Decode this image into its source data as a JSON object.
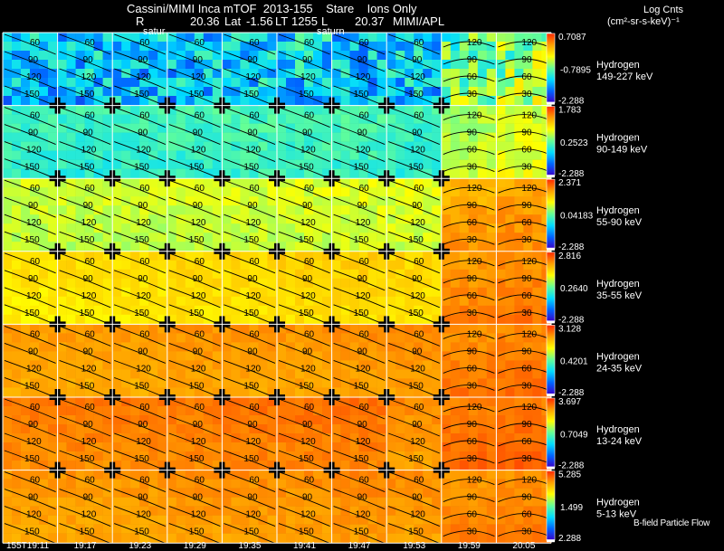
{
  "header": {
    "title_line": "Cassini/MIMI Inca mTOF  2013-155    Stare    Ions Only",
    "r_label": "R",
    "r_value": "20.36",
    "lat_label": "Lat",
    "lat_value": "-1.56",
    "lt_label": "LT",
    "lt_value": "1255",
    "l_label": "L",
    "l_value": "20.37",
    "org": "MIMI/APL",
    "saturn_labels": [
      "satur",
      "saturn"
    ]
  },
  "colorbar_title": "Log Cnts",
  "colorbar_units": "(cm²-sr-s-keV)⁻¹",
  "legend_footer": "B-field Particle Flow",
  "colors": {
    "background": "#000000",
    "text": "#ffffff",
    "grid": "#ffffff",
    "contour": "#000000",
    "colorbar_bottom": "#ffffff",
    "colorbar_stops": [
      "#3a00c8",
      "#0064ff",
      "#00dcff",
      "#64ff96",
      "#ffff00",
      "#ffa000",
      "#ff2800"
    ]
  },
  "chart_data": {
    "type": "heatmap",
    "title": "Cassini/MIMI Inca mTOF  2013-155    Stare    Ions Only",
    "x": [
      "155T19:11",
      "19:17",
      "19:23",
      "19:29",
      "19:35",
      "19:41",
      "19:47",
      "19:53",
      "19:59",
      "20:05"
    ],
    "contour_labels_tilted": [
      "60",
      "90",
      "120",
      "150"
    ],
    "contour_labels_arc": [
      "120",
      "90",
      "60",
      "30"
    ],
    "rows": [
      {
        "species": "Hydrogen",
        "energy": "149-227 keV",
        "max_label": "0.7087",
        "mid_label": "-0.7895",
        "min_label": "-2.288",
        "cmax": 0.7087,
        "cmin": -2.288,
        "level": [
          0.28,
          0.3,
          0.3,
          0.3,
          0.32,
          0.32,
          0.3,
          0.32,
          0.5,
          0.55
        ],
        "noise": 0.16
      },
      {
        "species": "Hydrogen",
        "energy": "90-149 keV",
        "max_label": "1.783",
        "mid_label": "0.2523",
        "min_label": "-2.288",
        "cmax": 1.783,
        "cmin": -2.288,
        "level": [
          0.42,
          0.42,
          0.43,
          0.43,
          0.44,
          0.44,
          0.44,
          0.42,
          0.6,
          0.64
        ],
        "noise": 0.05
      },
      {
        "species": "Hydrogen",
        "energy": "55-90 keV",
        "max_label": "2.371",
        "mid_label": "0.04183",
        "min_label": "-2.288",
        "cmax": 2.371,
        "cmin": -2.288,
        "level": [
          0.6,
          0.6,
          0.6,
          0.61,
          0.61,
          0.61,
          0.62,
          0.62,
          0.83,
          0.85
        ],
        "noise": 0.04
      },
      {
        "species": "Hydrogen",
        "energy": "35-55 keV",
        "max_label": "2.816",
        "mid_label": "0.2640",
        "min_label": "-2.288",
        "cmax": 2.816,
        "cmin": -2.288,
        "level": [
          0.7,
          0.71,
          0.71,
          0.72,
          0.72,
          0.73,
          0.73,
          0.72,
          0.86,
          0.88
        ],
        "noise": 0.03
      },
      {
        "species": "Hydrogen",
        "energy": "24-35 keV",
        "max_label": "3.128",
        "mid_label": "0.4201",
        "min_label": "-2.288",
        "cmax": 3.128,
        "cmin": -2.288,
        "level": [
          0.82,
          0.82,
          0.82,
          0.83,
          0.83,
          0.83,
          0.84,
          0.84,
          0.88,
          0.89
        ],
        "noise": 0.025
      },
      {
        "species": "Hydrogen",
        "energy": "13-24 keV",
        "max_label": "3.697",
        "mid_label": "0.7049",
        "min_label": "-2.288",
        "cmax": 3.697,
        "cmin": -2.288,
        "level": [
          0.87,
          0.87,
          0.87,
          0.87,
          0.88,
          0.88,
          0.88,
          0.84,
          0.9,
          0.91
        ],
        "noise": 0.025
      },
      {
        "species": "Hydrogen",
        "energy": "5-13 keV",
        "max_label": "5.285",
        "mid_label": "1.499",
        "min_label": "2.288",
        "cmax": 5.285,
        "cmin": -2.288,
        "level": [
          0.83,
          0.83,
          0.83,
          0.84,
          0.84,
          0.84,
          0.85,
          0.84,
          0.87,
          0.88
        ],
        "noise": 0.025
      }
    ]
  }
}
